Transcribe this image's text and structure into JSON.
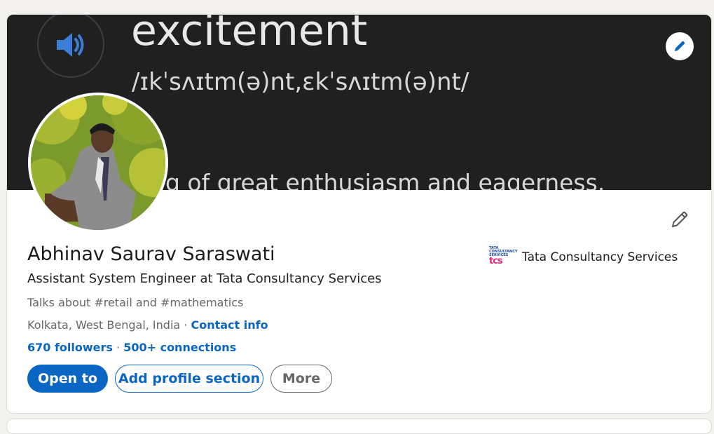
{
  "banner": {
    "word": "excitement",
    "phonetic": "/ɪkˈsʌɪtm(ə)nt,ɛkˈsʌɪtm(ə)nt/",
    "definition": "g of great enthusiasm and eagerness."
  },
  "profile": {
    "name": "Abhinav Saurav Saraswati",
    "headline": "Assistant System Engineer at Tata Consultancy Services",
    "talks_about": "Talks about #retail and #mathematics",
    "location": "Kolkata, West Bengal, India",
    "separator": " · ",
    "contact_info": "Contact info",
    "followers": "670 followers",
    "connections_separator": " · ",
    "connections": "500+ connections"
  },
  "company": {
    "logo_top": "TATA CONSULTANCY SERVICES",
    "logo_mark": "tcs",
    "name": "Tata Consultancy Services"
  },
  "actions": {
    "open_to": "Open to",
    "add_section": "Add profile section",
    "more": "More"
  },
  "colors": {
    "accent": "#0a66c2",
    "banner_bg": "#202020",
    "page_bg": "#f4f2ee",
    "tcs_pink": "#e2267e"
  },
  "icons": {
    "banner_speaker": "speaker-icon",
    "banner_edit": "pencil-icon",
    "intro_edit": "pencil-icon"
  }
}
